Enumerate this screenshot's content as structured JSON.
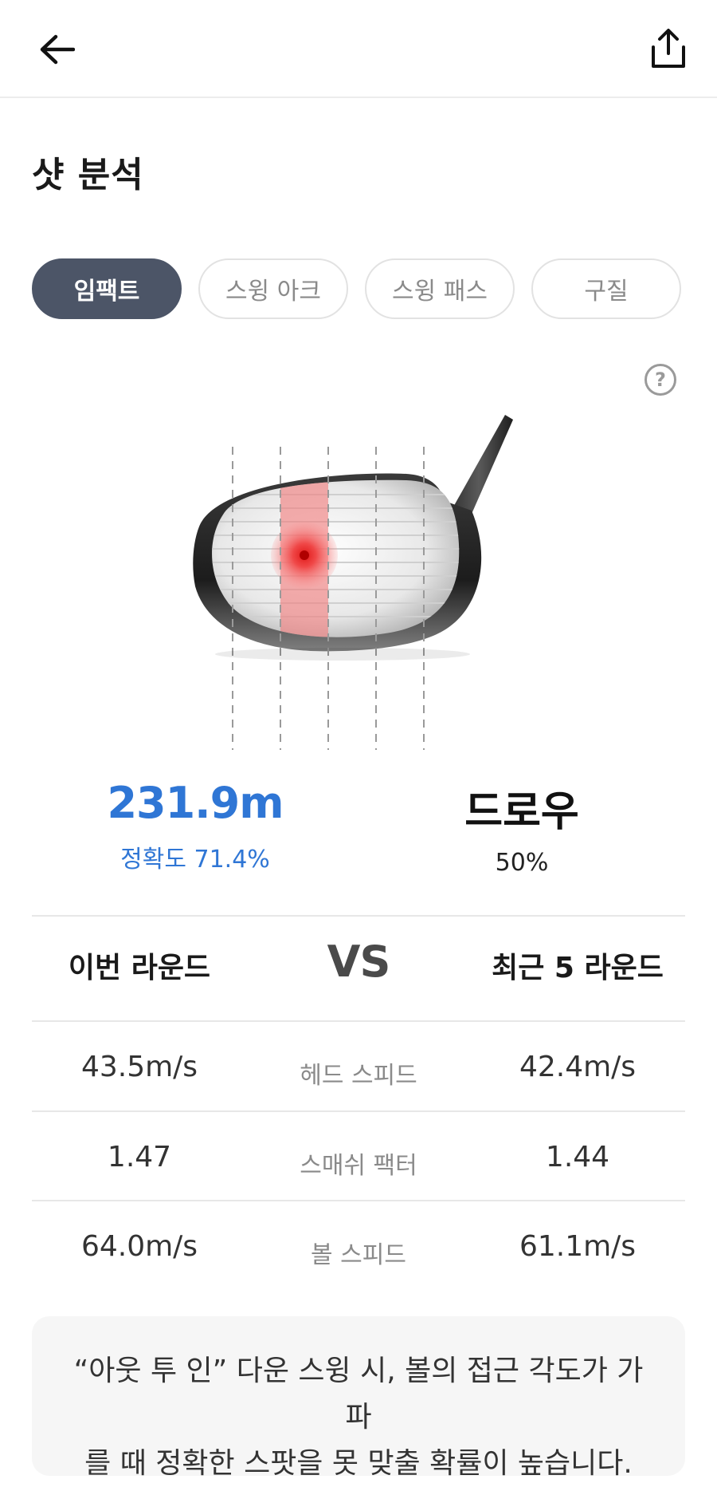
{
  "header": {
    "back_icon": "arrow-left-icon",
    "share_icon": "share-icon"
  },
  "page": {
    "title": "샷 분석"
  },
  "tabs": [
    {
      "label": "임팩트",
      "active": true
    },
    {
      "label": "스윙 아크",
      "active": false
    },
    {
      "label": "스윙 패스",
      "active": false
    },
    {
      "label": "구질",
      "active": false
    }
  ],
  "help": {
    "icon": "question-circle-icon",
    "glyph": "?"
  },
  "impact": {
    "distance": "231.9m",
    "accuracy": "정확도 71.4%",
    "shape": "드로우",
    "shape_pct": "50%"
  },
  "comparison": {
    "left_title": "이번 라운드",
    "vs": "VS",
    "right_title": "최근 5 라운드",
    "rows": [
      {
        "label": "헤드 스피드",
        "left": "43.5m/s",
        "right": "42.4m/s"
      },
      {
        "label": "스매쉬 팩터",
        "left": "1.47",
        "right": "1.44"
      },
      {
        "label": "볼 스피드",
        "left": "64.0m/s",
        "right": "61.1m/s"
      }
    ]
  },
  "tip": {
    "line1": "“아웃 투 인” 다운 스윙 시, 볼의 접근 각도가 가파",
    "line2": "를 때 정확한 스팟을 못 맞출 확률이 높습니다."
  },
  "colors": {
    "accent": "#2f76d5",
    "tab_active": "#4c5567",
    "impact_zone": "#f04848"
  }
}
